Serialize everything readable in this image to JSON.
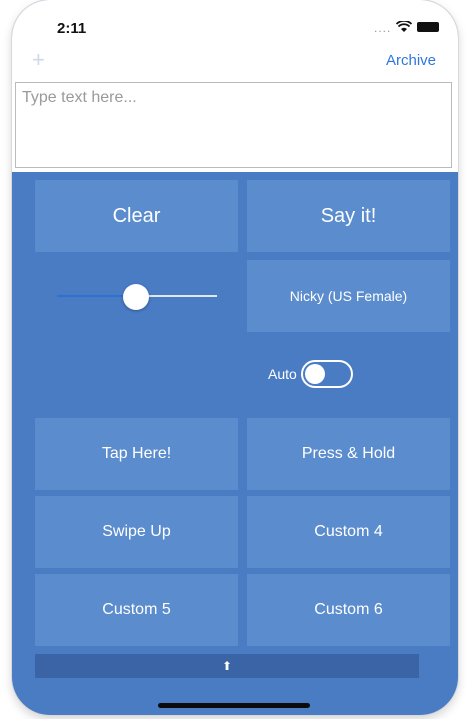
{
  "status_bar": {
    "time": "2:11",
    "signal": "....",
    "wifi_icon": "wifi-icon",
    "battery_icon": "battery-icon"
  },
  "nav": {
    "add_icon": "plus-icon",
    "archive_label": "Archive"
  },
  "text_input": {
    "placeholder": "Type text here...",
    "value": ""
  },
  "actions": {
    "clear_label": "Clear",
    "say_label": "Say it!"
  },
  "voice": {
    "name": "Nicky (US Female)",
    "rate_level": 0.5
  },
  "auto": {
    "label": "Auto",
    "on": false
  },
  "shortcuts": [
    {
      "label": "Tap Here!"
    },
    {
      "label": "Press & Hold"
    },
    {
      "label": "Swipe Up"
    },
    {
      "label": "Custom 4"
    },
    {
      "label": "Custom 5"
    },
    {
      "label": "Custom 6"
    }
  ],
  "footer": {
    "arrow_glyph": "⬆"
  },
  "colors": {
    "panel": "#4a7cc4",
    "button": "#5b8ccd",
    "accent": "#2f77e0"
  }
}
